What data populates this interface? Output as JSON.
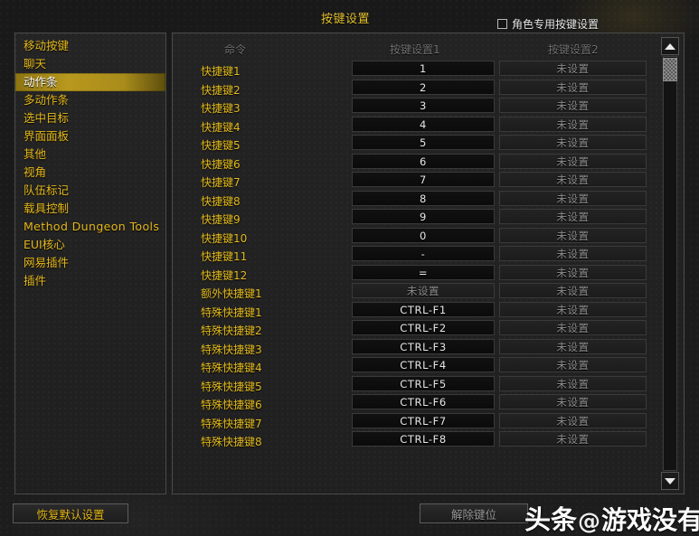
{
  "header": {
    "title": "按键设置",
    "character_specific": {
      "label": "角色专用按键设置",
      "checked": false
    }
  },
  "sidebar": {
    "items": [
      {
        "label": "移动按键",
        "selected": false,
        "latin": false
      },
      {
        "label": "聊天",
        "selected": false,
        "latin": false
      },
      {
        "label": "动作条",
        "selected": true,
        "latin": false
      },
      {
        "label": "多动作条",
        "selected": false,
        "latin": false
      },
      {
        "label": "选中目标",
        "selected": false,
        "latin": false
      },
      {
        "label": "界面面板",
        "selected": false,
        "latin": false
      },
      {
        "label": "其他",
        "selected": false,
        "latin": false
      },
      {
        "label": "视角",
        "selected": false,
        "latin": false
      },
      {
        "label": "队伍标记",
        "selected": false,
        "latin": false
      },
      {
        "label": "载具控制",
        "selected": false,
        "latin": false
      },
      {
        "label": "Method Dungeon Tools",
        "selected": false,
        "latin": true
      },
      {
        "label": "EUI核心",
        "selected": false,
        "latin": false
      },
      {
        "label": "网易插件",
        "selected": false,
        "latin": false
      },
      {
        "label": "插件",
        "selected": false,
        "latin": false
      }
    ]
  },
  "main": {
    "columns": [
      "命令",
      "按键设置1",
      "按键设置2"
    ],
    "unset_label": "未设置",
    "rows": [
      {
        "command": "快捷键1",
        "bind1": "1",
        "bind2": "未设置"
      },
      {
        "command": "快捷键2",
        "bind1": "2",
        "bind2": "未设置"
      },
      {
        "command": "快捷键3",
        "bind1": "3",
        "bind2": "未设置"
      },
      {
        "command": "快捷键4",
        "bind1": "4",
        "bind2": "未设置"
      },
      {
        "command": "快捷键5",
        "bind1": "5",
        "bind2": "未设置"
      },
      {
        "command": "快捷键6",
        "bind1": "6",
        "bind2": "未设置"
      },
      {
        "command": "快捷键7",
        "bind1": "7",
        "bind2": "未设置"
      },
      {
        "command": "快捷键8",
        "bind1": "8",
        "bind2": "未设置"
      },
      {
        "command": "快捷键9",
        "bind1": "9",
        "bind2": "未设置"
      },
      {
        "command": "快捷键10",
        "bind1": "0",
        "bind2": "未设置"
      },
      {
        "command": "快捷键11",
        "bind1": "-",
        "bind2": "未设置"
      },
      {
        "command": "快捷键12",
        "bind1": "=",
        "bind2": "未设置"
      },
      {
        "command": "额外快捷键1",
        "bind1": "未设置",
        "bind2": "未设置"
      },
      {
        "command": "特殊快捷键1",
        "bind1": "CTRL-F1",
        "bind2": "未设置"
      },
      {
        "command": "特殊快捷键2",
        "bind1": "CTRL-F2",
        "bind2": "未设置"
      },
      {
        "command": "特殊快捷键3",
        "bind1": "CTRL-F3",
        "bind2": "未设置"
      },
      {
        "command": "特殊快捷键4",
        "bind1": "CTRL-F4",
        "bind2": "未设置"
      },
      {
        "command": "特殊快捷键5",
        "bind1": "CTRL-F5",
        "bind2": "未设置"
      },
      {
        "command": "特殊快捷键6",
        "bind1": "CTRL-F6",
        "bind2": "未设置"
      },
      {
        "command": "特殊快捷键7",
        "bind1": "CTRL-F7",
        "bind2": "未设置"
      },
      {
        "command": "特殊快捷键8",
        "bind1": "CTRL-F8",
        "bind2": "未设置"
      }
    ]
  },
  "scrollbar": {
    "up_icon": "chevron-up-icon",
    "down_icon": "chevron-down-icon"
  },
  "footer": {
    "restore_defaults_label": "恢复默认设置",
    "unbind_label": "解除键位"
  },
  "watermark": {
    "brand": "头条",
    "at": "@",
    "name": "游戏没有圈儿"
  },
  "colors": {
    "accent_gold": "#e6b919",
    "selected_bg": "#b8981d",
    "panel_border": "#4a4a4a",
    "unset_text": "#8c8c8c",
    "set_text": "#e8e8e8"
  }
}
